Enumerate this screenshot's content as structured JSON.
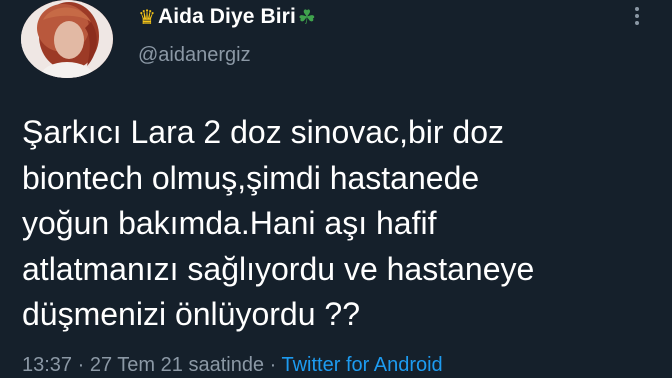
{
  "user": {
    "display_name": "Aida Diye Biri",
    "handle": "@aidanergiz",
    "name_prefix_icon": "crown-icon",
    "name_suffix_icon": "four-leaf-clover-icon"
  },
  "tweet": {
    "text_lines": [
      "Şarkıcı Lara 2 doz sinovac,bir doz",
      "biontech olmuş,şimdi hastanede",
      "yoğun bakımda.Hani aşı hafif",
      "atlatmanızı sağlıyordu ve hastaneye",
      "düşmenizi önlüyordu ??"
    ],
    "time": "13:37",
    "separator": "·",
    "date": "27 Tem 21 saatinde",
    "source": "Twitter for Android"
  },
  "colors": {
    "background": "#15202b",
    "text": "#ffffff",
    "secondary_text": "#8b98a5",
    "link": "#1d9bf0"
  }
}
